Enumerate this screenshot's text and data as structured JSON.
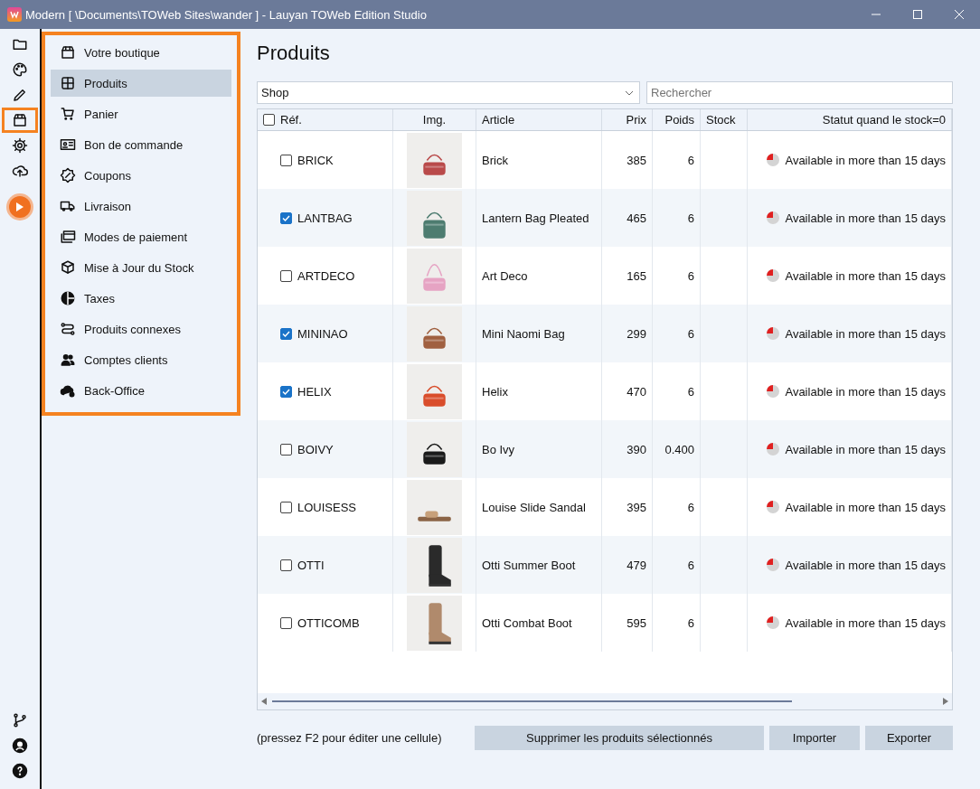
{
  "window": {
    "title": "Modern [ \\Documents\\TOWeb Sites\\wander ] - Lauyan TOWeb Edition Studio"
  },
  "rail": [
    {
      "selected": false
    },
    {
      "selected": false
    },
    {
      "selected": false
    },
    {
      "selected": true
    },
    {
      "selected": false
    },
    {
      "selected": false
    }
  ],
  "rail_bottom": [
    {
      "selected": false
    },
    {
      "selected": false
    },
    {
      "selected": false
    }
  ],
  "menu": [
    {
      "label": "Votre boutique",
      "selected": false
    },
    {
      "label": "Produits",
      "selected": true
    },
    {
      "label": "Panier",
      "selected": false
    },
    {
      "label": "Bon de commande",
      "selected": false
    },
    {
      "label": "Coupons",
      "selected": false
    },
    {
      "label": "Livraison",
      "selected": false
    },
    {
      "label": "Modes de paiement",
      "selected": false
    },
    {
      "label": "Mise à Jour du Stock",
      "selected": false
    },
    {
      "label": "Taxes",
      "selected": false
    },
    {
      "label": "Produits connexes",
      "selected": false
    },
    {
      "label": "Comptes clients",
      "selected": false
    },
    {
      "label": "Back-Office",
      "selected": false
    }
  ],
  "page_title": "Produits",
  "category_select": {
    "value": "Shop"
  },
  "search": {
    "placeholder": "Rechercher"
  },
  "table": {
    "select_all": {
      "checked": false
    },
    "columns": [
      "Réf.",
      "Img.",
      "Article",
      "Prix",
      "Poids",
      "Stock",
      "Statut quand le stock=0"
    ],
    "rows": [
      {
        "ref": "BRICK",
        "checked": false,
        "article": "Brick",
        "price": "385",
        "weight": "6",
        "status": "Available in more than 15 days"
      },
      {
        "ref": "LANTBAG",
        "checked": true,
        "article": "Lantern Bag Pleated",
        "price": "465",
        "weight": "6",
        "status": "Available in more than 15 days"
      },
      {
        "ref": "ARTDECO",
        "checked": false,
        "article": "Art Deco",
        "price": "165",
        "weight": "6",
        "status": "Available in more than 15 days"
      },
      {
        "ref": "MININAO",
        "checked": true,
        "article": "Mini Naomi Bag",
        "price": "299",
        "weight": "6",
        "status": "Available in more than 15 days"
      },
      {
        "ref": "HELIX",
        "checked": true,
        "article": "Helix",
        "price": "470",
        "weight": "6",
        "status": "Available in more than 15 days"
      },
      {
        "ref": "BOIVY",
        "checked": false,
        "article": "Bo Ivy",
        "price": "390",
        "weight": "0.400",
        "status": "Available in more than 15 days"
      },
      {
        "ref": "LOUISESS",
        "checked": false,
        "article": "Louise Slide Sandal",
        "price": "395",
        "weight": "6",
        "status": "Available in more than 15 days"
      },
      {
        "ref": "OTTI",
        "checked": false,
        "article": "Otti Summer Boot",
        "price": "479",
        "weight": "6",
        "status": "Available in more than 15 days"
      },
      {
        "ref": "OTTICOMB",
        "checked": false,
        "article": "Otti Combat Boot",
        "price": "595",
        "weight": "6",
        "status": "Available in more than 15 days"
      }
    ]
  },
  "hint": "(pressez F2 pour éditer une cellule)",
  "buttons": [
    "Supprimer les produits sélectionnés",
    "Importer",
    "Exporter"
  ]
}
